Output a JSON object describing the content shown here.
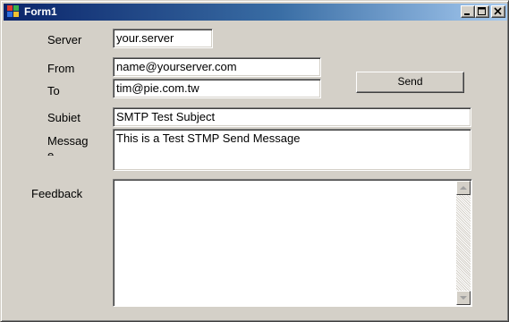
{
  "window": {
    "title": "Form1"
  },
  "form": {
    "server": {
      "label": "Server",
      "value": "your.server"
    },
    "from": {
      "label": "From",
      "value": "name@yourserver.com"
    },
    "to": {
      "label": "To",
      "value": "tim@pie.com.tw"
    },
    "subject": {
      "label": "Subjet",
      "value": "SMTP Test Subject"
    },
    "message": {
      "label_line1": "Messag",
      "label_line2": "e",
      "value": "This is a Test STMP Send Message"
    },
    "send_button": "Send",
    "feedback": {
      "label": "Feedback",
      "value": ""
    }
  },
  "icons": {
    "app": "app-icon",
    "minimize": "minimize-icon",
    "maximize": "maximize-icon",
    "close": "close-icon",
    "scroll_up": "scroll-up-arrow-icon",
    "scroll_down": "scroll-down-arrow-icon"
  },
  "colors": {
    "title_gradient_start": "#0a246a",
    "title_gradient_end": "#a6caf0",
    "face": "#d4d0c8"
  }
}
